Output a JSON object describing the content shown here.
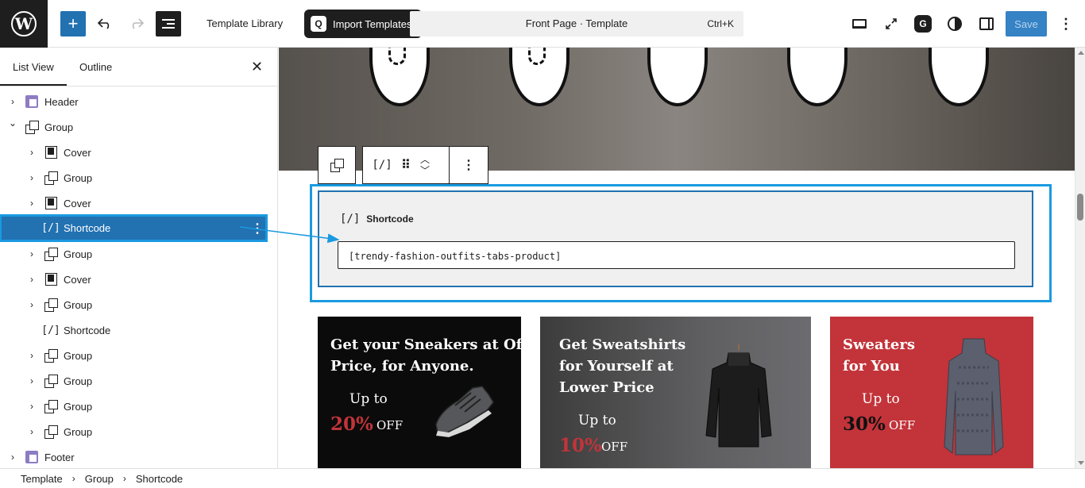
{
  "topbar": {
    "template_library": "Template Library",
    "import_templates": "Import Templates",
    "command_title": "Front Page · Template",
    "command_shortcut": "Ctrl+K",
    "save": "Save"
  },
  "left_panel": {
    "tabs": [
      "List View",
      "Outline"
    ],
    "items": [
      {
        "label": "Header",
        "icon": "header-icon",
        "level": 0,
        "expandable": true
      },
      {
        "label": "Group",
        "icon": "group-icon",
        "level": 0,
        "expandable": true,
        "expanded": true
      },
      {
        "label": "Cover",
        "icon": "cover-icon",
        "level": 1,
        "expandable": true
      },
      {
        "label": "Group",
        "icon": "group-icon",
        "level": 1,
        "expandable": true
      },
      {
        "label": "Cover",
        "icon": "cover-icon",
        "level": 1,
        "expandable": true
      },
      {
        "label": "Shortcode",
        "icon": "shortcode-icon",
        "level": 1,
        "expandable": false,
        "selected": true
      },
      {
        "label": "Group",
        "icon": "group-icon",
        "level": 1,
        "expandable": true
      },
      {
        "label": "Cover",
        "icon": "cover-icon",
        "level": 1,
        "expandable": true
      },
      {
        "label": "Group",
        "icon": "group-icon",
        "level": 1,
        "expandable": true
      },
      {
        "label": "Shortcode",
        "icon": "shortcode-icon",
        "level": 1,
        "expandable": false
      },
      {
        "label": "Group",
        "icon": "group-icon",
        "level": 1,
        "expandable": true
      },
      {
        "label": "Group",
        "icon": "group-icon",
        "level": 1,
        "expandable": true
      },
      {
        "label": "Group",
        "icon": "group-icon",
        "level": 1,
        "expandable": true
      },
      {
        "label": "Group",
        "icon": "group-icon",
        "level": 1,
        "expandable": true
      },
      {
        "label": "Footer",
        "icon": "footer-icon",
        "level": 0,
        "expandable": true
      }
    ]
  },
  "canvas": {
    "block_toolbar": {
      "shortcode_glyph": "[/]"
    },
    "shortcode_block": {
      "title": "Shortcode",
      "glyph": "[/]",
      "value": "[trendy-fashion-outfits-tabs-product]"
    },
    "promos": [
      {
        "title_lines": [
          "Get your Sneakers at Offer",
          "Price, for Anyone."
        ],
        "upto": "Up to",
        "percent": "20%",
        "off": "OFF",
        "percent_color": "#c2343a"
      },
      {
        "title_lines": [
          "Get Sweatshirts",
          "for Yourself at",
          "Lower Price"
        ],
        "upto": "Up to",
        "percent": "10%",
        "off": "OFF",
        "percent_color": "#c2343a"
      },
      {
        "title_lines": [
          "Sweaters",
          "for You"
        ],
        "upto": "Up to",
        "percent": "30%",
        "off": "OFF",
        "percent_color": "#111111"
      }
    ]
  },
  "breadcrumb": [
    "Template",
    "Group",
    "Shortcode"
  ],
  "colors": {
    "accent": "#2271b1",
    "highlight": "#1a9ae0",
    "dark": "#1e1e1e"
  }
}
